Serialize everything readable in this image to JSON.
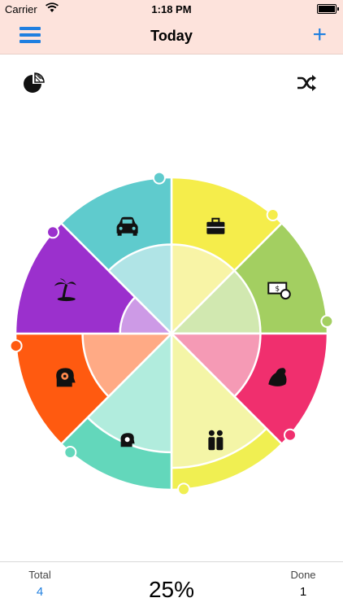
{
  "status_bar": {
    "carrier": "Carrier",
    "time": "1:18 PM"
  },
  "nav": {
    "title": "Today",
    "add_label": "+"
  },
  "toolbar": {
    "chart_icon": "pie-chart-icon",
    "shuffle_icon": "shuffle-icon"
  },
  "wheel": {
    "segments": [
      {
        "icon": "briefcase-icon",
        "outer": "#f5ed4b",
        "inner": "#f8f4a6",
        "fill": 0.57
      },
      {
        "icon": "money-icon",
        "outer": "#a3cf61",
        "inner": "#d1e8b0",
        "fill": 0.57
      },
      {
        "icon": "flexed-arm-icon",
        "outer": "#f02f6e",
        "inner": "#f59ab5",
        "fill": 0.57
      },
      {
        "icon": "couple-icon",
        "outer": "#f0ef52",
        "inner": "#f4f5a7",
        "fill": 0.86
      },
      {
        "icon": "brain-gear-icon",
        "outer": "#63d7bb",
        "inner": "#b1ecdd",
        "fill": 0.76
      },
      {
        "icon": "head-gear-icon",
        "outer": "#ff5a10",
        "inner": "#ffaa85",
        "fill": 0.57
      },
      {
        "icon": "palm-tree-icon",
        "outer": "#9b30cd",
        "inner": "#cd9ae6",
        "fill": 0.33
      },
      {
        "icon": "car-icon",
        "outer": "#5fcbcd",
        "inner": "#b0e4e6",
        "fill": 0.57
      }
    ],
    "border_color": "#ffffff"
  },
  "footer": {
    "total_label": "Total",
    "total_value": "4",
    "percent": "25%",
    "done_label": "Done",
    "done_value": "1"
  }
}
